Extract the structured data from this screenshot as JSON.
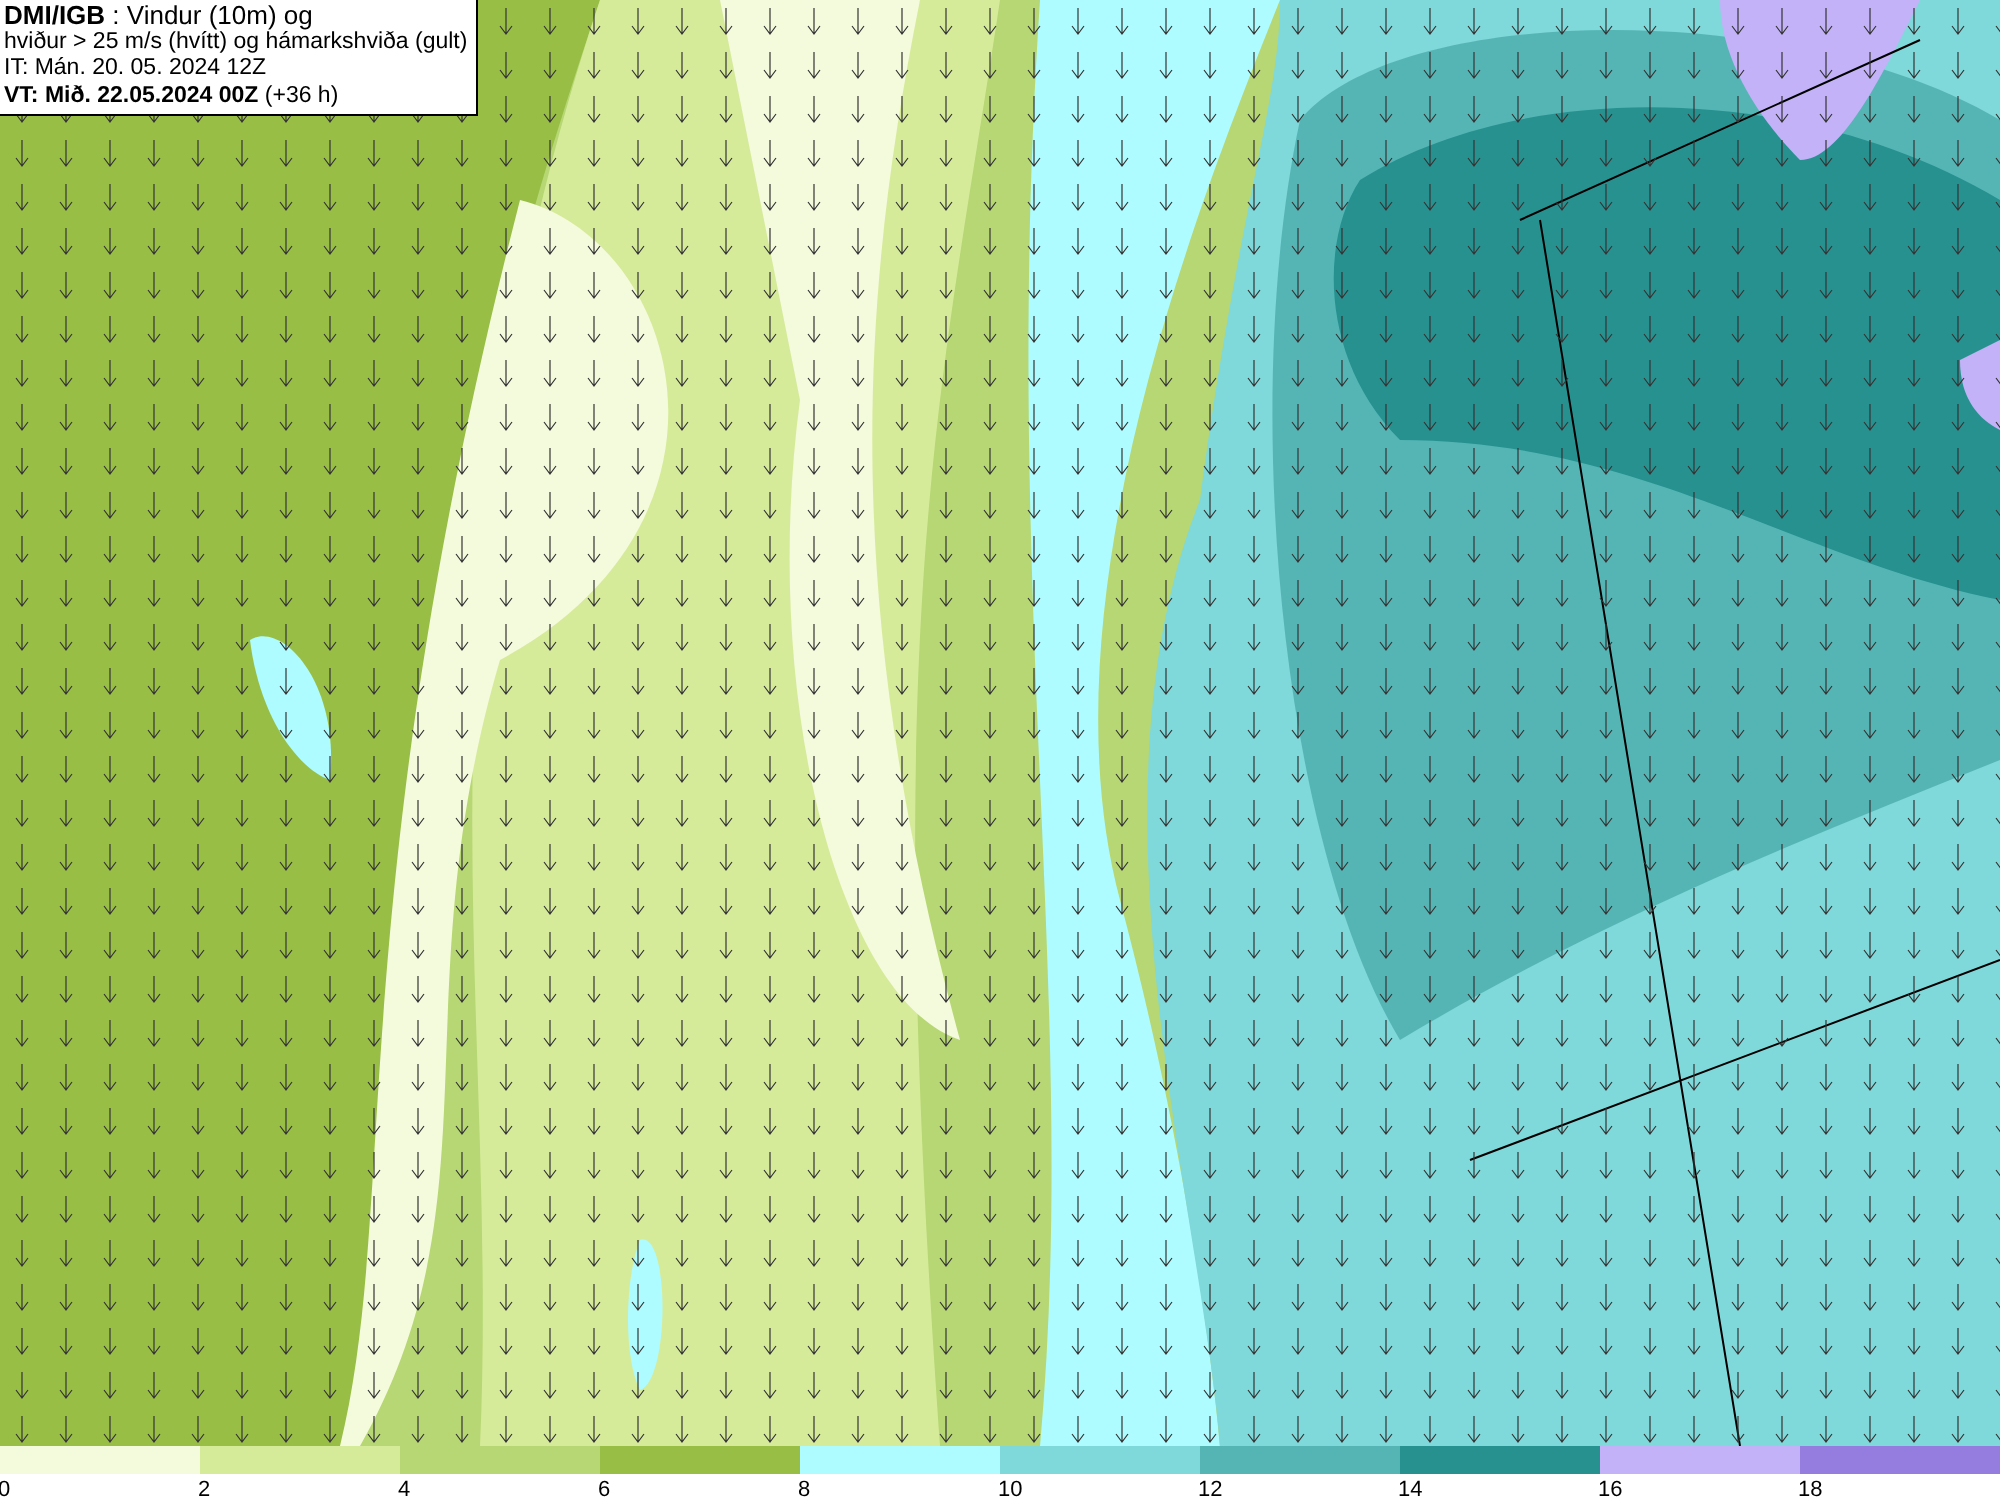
{
  "title_box": {
    "lines": [
      "**DMI/IGB** : Vindur (10m) og",
      "hviður > 25 m/s (hvítt) og hámarkshviða (gult)",
      "IT: Mán. 20. 05. 2024 12Z",
      "**VT: Mið. 22.05.2024 00Z** (+36 h)"
    ]
  },
  "legend": {
    "bins": [
      {
        "color": "#f4fadc",
        "label": "0"
      },
      {
        "color": "#d6eb9a",
        "label": "2"
      },
      {
        "color": "#b6d773",
        "label": "4"
      },
      {
        "color": "#98be45",
        "label": "6"
      },
      {
        "color": "#aefcff",
        "label": "8"
      },
      {
        "color": "#7fd8d9",
        "label": "10"
      },
      {
        "color": "#55b5b5",
        "label": "12"
      },
      {
        "color": "#279190",
        "label": "14"
      },
      {
        "color": "#c3b2f8",
        "label": "16"
      },
      {
        "color": "#957ddf",
        "label": "18"
      }
    ]
  }
}
